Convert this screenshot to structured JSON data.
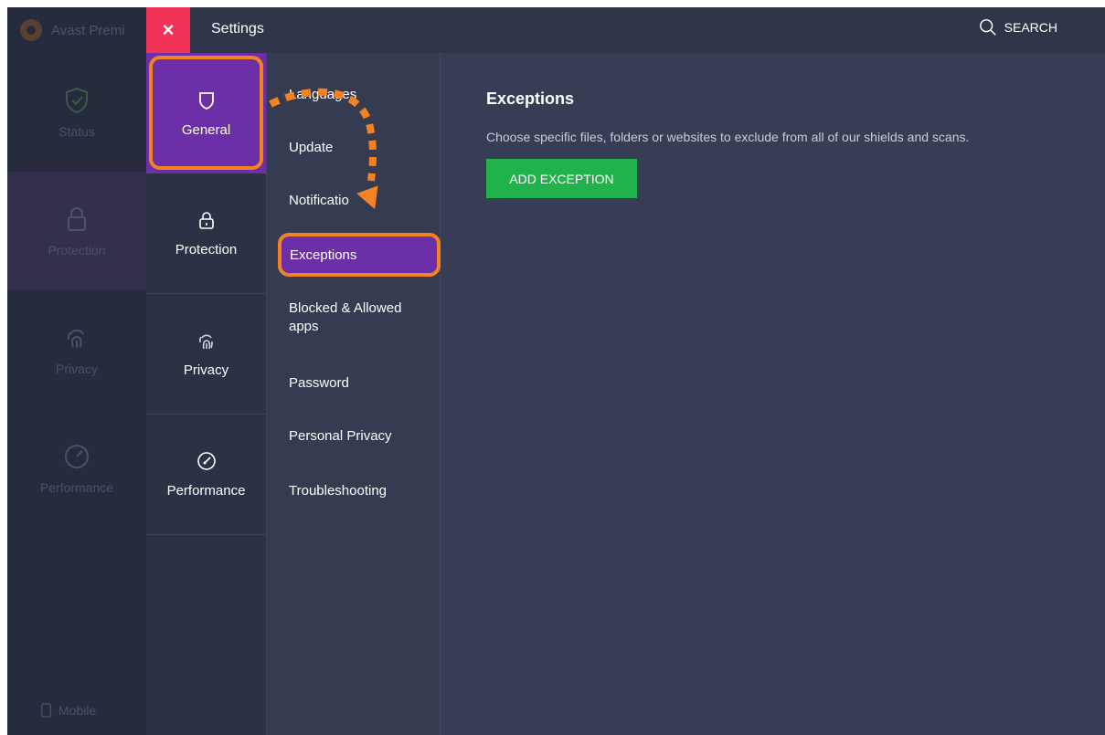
{
  "background_window": {
    "title": "Avast Premi",
    "nav": [
      {
        "label": "Status"
      },
      {
        "label": "Protection"
      },
      {
        "label": "Privacy"
      },
      {
        "label": "Performance"
      }
    ],
    "mobile_label": "Mobile"
  },
  "titlebar": {
    "close_label": "×",
    "title": "Settings",
    "search_label": "SEARCH"
  },
  "categories": [
    {
      "label": "General"
    },
    {
      "label": "Protection"
    },
    {
      "label": "Privacy"
    },
    {
      "label": "Performance"
    }
  ],
  "submenu": {
    "items": [
      "Languages",
      "Update",
      "Notificatio",
      "Exceptions",
      "Blocked & Allowed apps",
      "Password",
      "Personal Privacy",
      "Troubleshooting"
    ]
  },
  "content": {
    "title": "Exceptions",
    "description": "Choose specific files, folders or websites to exclude from all of our shields and scans.",
    "add_button": "ADD EXCEPTION"
  },
  "colors": {
    "accent_purple": "#6c2fa8",
    "highlight_orange": "#f58220",
    "close_red": "#f03356",
    "button_green": "#21b24b"
  }
}
